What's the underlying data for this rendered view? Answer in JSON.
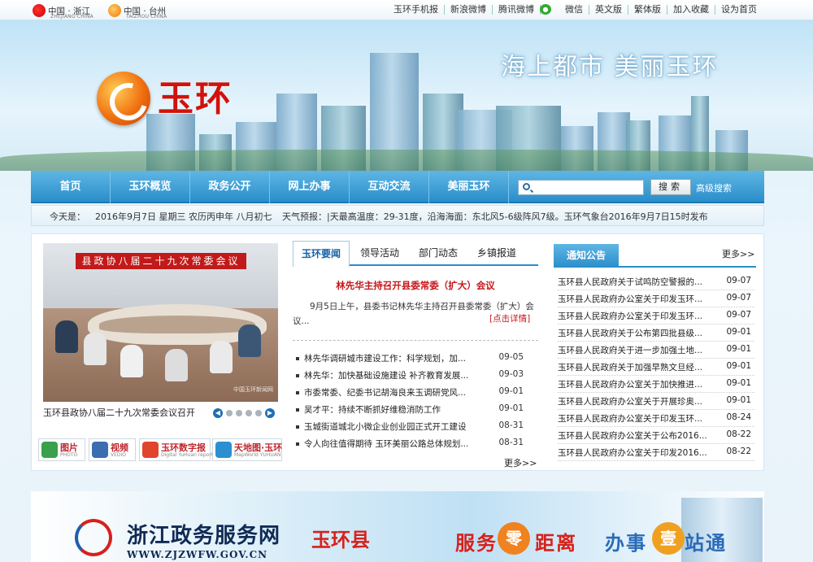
{
  "topbar": {
    "site1": {
      "label": "中国 · 浙江",
      "sub": "ZHEJIANG·CHINA"
    },
    "site2": {
      "label": "中国 · 台州",
      "sub": "TAIZHOU·CHINA"
    },
    "links": [
      "玉环手机报",
      "新浪微博",
      "腾讯微博",
      "微信",
      "英文版",
      "繁体版",
      "加入收藏",
      "设为首页"
    ]
  },
  "banner": {
    "slogan": "海上都市 美丽玉环",
    "logo_text": "玉环"
  },
  "nav": {
    "items": [
      "首页",
      "玉环概览",
      "政务公开",
      "网上办事",
      "互动交流",
      "美丽玉环"
    ],
    "search_button": "搜索",
    "advanced_search": "高级搜索"
  },
  "infobar": {
    "today_label": "今天是：",
    "date": "2016年9月7日 星期三 农历丙申年 八月初七",
    "weather": "天气预报：|天最高温度：29-31度，沿海海面：东北风5-6级阵风7级。玉环气象台2016年9月7日15时发布"
  },
  "slideshow": {
    "banner_text": "县政协八届二十九次常委会议",
    "watermark": "中国玉环新闻网",
    "caption": "玉环县政协八届二十九次常委会议召开"
  },
  "quicklinks": [
    {
      "title": "图片",
      "sub": "PHOTO",
      "color": "#3aa04b"
    },
    {
      "title": "视频",
      "sub": "VEDIO",
      "color": "#3c6db0"
    },
    {
      "title": "玉环数字报",
      "sub": "Digital YuHuan reported",
      "color": "#e0442c"
    },
    {
      "title": "天地图·玉环",
      "sub": "MapWorld YUHUAN",
      "color": "#2b8fd0"
    }
  ],
  "news": {
    "tabs": [
      "玉环要闻",
      "领导活动",
      "部门动态",
      "乡镇报道"
    ],
    "headline": "林先华主持召开县委常委（扩大）会议",
    "summary": "9月5日上午，县委书记林先华主持召开县委常委（扩大）会议...",
    "readmore": "[点击详情]",
    "items": [
      {
        "title": "林先华调研城市建设工作：科学规划，加...",
        "date": "09-05"
      },
      {
        "title": "林先华：加快基础设施建设 补齐教育发展...",
        "date": "09-03"
      },
      {
        "title": "市委常委、纪委书记胡海良来玉调研党风...",
        "date": "09-01"
      },
      {
        "title": "吴才平：持续不断抓好维稳消防工作",
        "date": "09-01"
      },
      {
        "title": "玉城街道城北小微企业创业园正式开工建设",
        "date": "08-31"
      },
      {
        "title": "令人向往值得期待 玉环美丽公路总体规划...",
        "date": "08-31"
      }
    ],
    "more": "更多>>"
  },
  "notices": {
    "tab": "通知公告",
    "more": "更多>>",
    "items": [
      {
        "title": "玉环县人民政府关于试鸣防空警报的...",
        "date": "09-07"
      },
      {
        "title": "玉环县人民政府办公室关于印发玉环...",
        "date": "09-07"
      },
      {
        "title": "玉环县人民政府办公室关于印发玉环...",
        "date": "09-07"
      },
      {
        "title": "玉环县人民政府关于公布第四批县级...",
        "date": "09-01"
      },
      {
        "title": "玉环县人民政府关于进一步加强土地...",
        "date": "09-01"
      },
      {
        "title": "玉环县人民政府关于加强早熟文旦经...",
        "date": "09-01"
      },
      {
        "title": "玉环县人民政府办公室关于加快推进...",
        "date": "09-01"
      },
      {
        "title": "玉环县人民政府办公室关于开展珍奥...",
        "date": "09-01"
      },
      {
        "title": "玉环县人民政府办公室关于印发玉环...",
        "date": "08-24"
      },
      {
        "title": "玉环县人民政府办公室关于公布2016...",
        "date": "08-22"
      },
      {
        "title": "玉环县人民政府办公室关于印发2016...",
        "date": "08-22"
      }
    ]
  },
  "footer_banner": {
    "title": "浙江政务服务网",
    "county": "玉环县",
    "url": "WWW.ZJZWFW.GOV.CN",
    "slogan1": [
      "服务",
      "零",
      "距离"
    ],
    "slogan2": [
      "办事",
      "壹",
      "站通"
    ]
  }
}
